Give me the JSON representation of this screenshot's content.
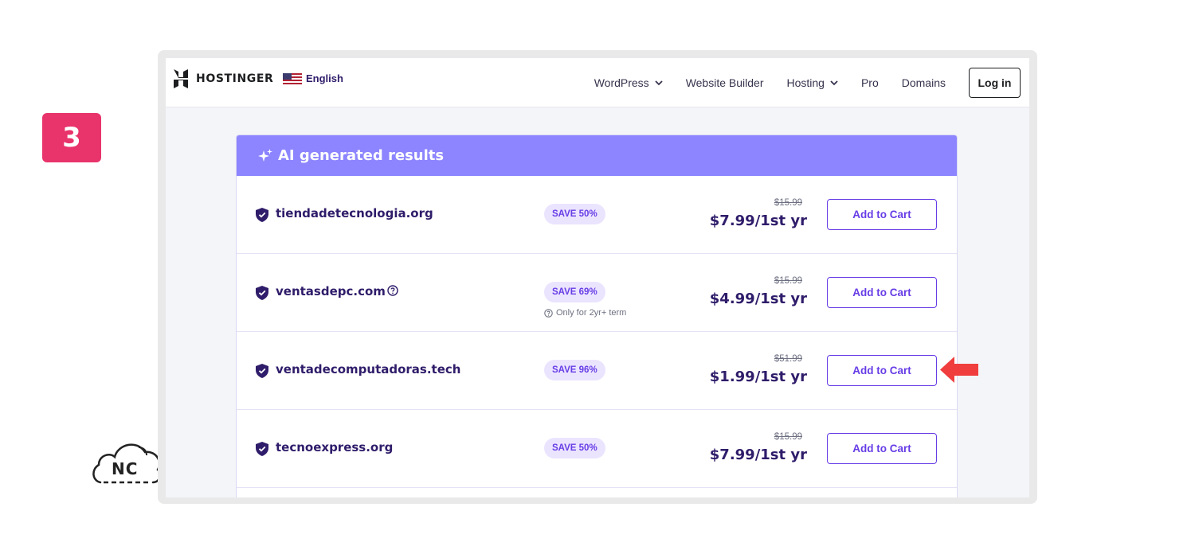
{
  "step": {
    "number": "3"
  },
  "watermark": {
    "text": "NC"
  },
  "navbar": {
    "brand": "HOSTINGER",
    "language": "English",
    "links": [
      {
        "label": "WordPress",
        "has_dropdown": true
      },
      {
        "label": "Website Builder",
        "has_dropdown": false
      },
      {
        "label": "Hosting",
        "has_dropdown": true
      },
      {
        "label": "Pro",
        "has_dropdown": false
      },
      {
        "label": "Domains",
        "has_dropdown": false
      }
    ],
    "login_label": "Log in"
  },
  "results": {
    "title": "AI generated results",
    "rows": [
      {
        "domain": "tiendadetecnologia.org",
        "save": "SAVE 50%",
        "old_price": "$15.99",
        "price": "$7.99/1st yr",
        "button": "Add to Cart"
      },
      {
        "domain": "ventasdepc.com",
        "save": "SAVE 69%",
        "note": "Only for 2yr+ term",
        "old_price": "$15.99",
        "price": "$4.99/1st yr",
        "button": "Add to Cart"
      },
      {
        "domain": "ventadecomputadoras.tech",
        "save": "SAVE 96%",
        "old_price": "$51.99",
        "price": "$1.99/1st yr",
        "button": "Add to Cart"
      },
      {
        "domain": "tecnoexpress.org",
        "save": "SAVE 50%",
        "old_price": "$15.99",
        "price": "$7.99/1st yr",
        "button": "Add to Cart"
      }
    ]
  },
  "colors": {
    "brand_purple": "#673de6",
    "header_purple": "#8c85ff",
    "step_badge": "#e8336b",
    "arrow_red": "#f03e3e"
  },
  "icons": [
    "hostinger-logo-icon",
    "us-flag-icon",
    "chevron-down-icon",
    "sparkle-icon",
    "shield-check-icon",
    "help-circle-icon",
    "red-arrow-icon",
    "cloud-icon"
  ]
}
